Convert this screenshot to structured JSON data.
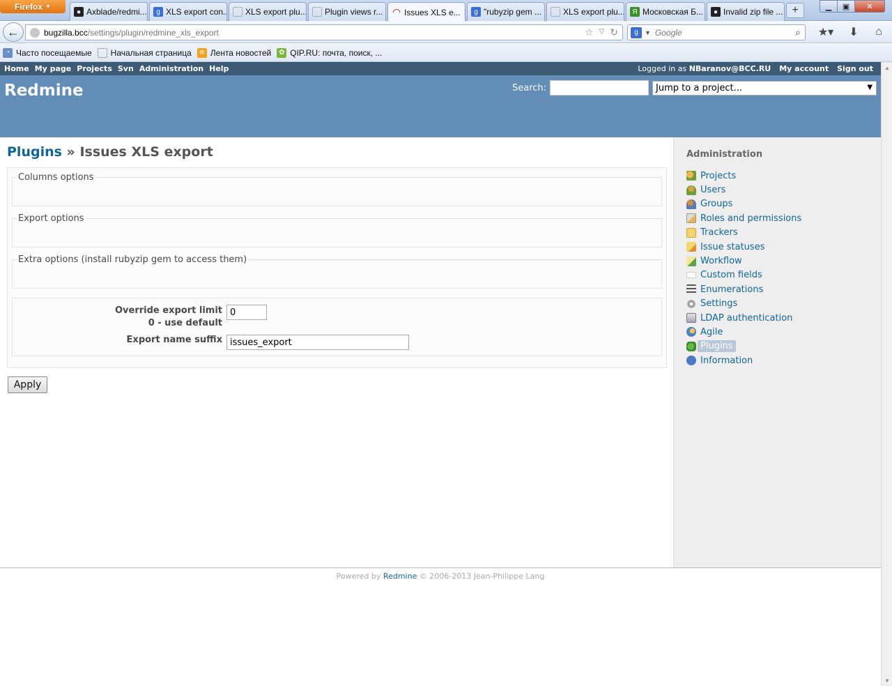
{
  "browser": {
    "menu_button": "Firefox",
    "tabs": [
      {
        "label": "Axblade/redmi...",
        "icon": "github-icon"
      },
      {
        "label": "XLS export con...",
        "icon": "google-icon"
      },
      {
        "label": "XLS export plu...",
        "icon": "blank-page-icon"
      },
      {
        "label": "Plugin views r...",
        "icon": "blank-page-icon"
      },
      {
        "label": "Issues XLS e...",
        "icon": "redmine-icon",
        "active": true
      },
      {
        "label": "\"rubyzip gem ...",
        "icon": "google-icon"
      },
      {
        "label": "XLS export plu...",
        "icon": "blank-page-icon"
      },
      {
        "label": "Московская Б...",
        "icon": "yandex-icon"
      },
      {
        "label": "Invalid zip file ...",
        "icon": "github-icon"
      }
    ],
    "url_host": "bugzilla.bcc",
    "url_path": "/settings/plugin/redmine_xls_export",
    "search_placeholder": "Google",
    "bookmarks": [
      {
        "label": "Часто посещаемые",
        "icon": "most-visited-icon"
      },
      {
        "label": "Начальная страница",
        "icon": "blank-page-icon"
      },
      {
        "label": "Лента новостей",
        "icon": "rss-icon"
      },
      {
        "label": "QIP.RU: почта, поиск, ...",
        "icon": "qip-icon"
      }
    ]
  },
  "top_menu": {
    "items": [
      "Home",
      "My page",
      "Projects",
      "Svn",
      "Administration",
      "Help"
    ],
    "logged_in_prefix": "Logged in as",
    "logged_in_user": "NBaranov@BCC.RU",
    "my_account": "My account",
    "sign_out": "Sign out"
  },
  "header": {
    "site_title": "Redmine",
    "search_label": "Search:",
    "jump_placeholder": "Jump to a project..."
  },
  "content": {
    "breadcrumb_link": "Plugins",
    "breadcrumb_sep": "»",
    "title": "Issues XLS export",
    "fieldsets": {
      "columns": "Columns options",
      "export": "Export options",
      "extra": "Extra options (install rubyzip gem to access them)"
    },
    "fields": {
      "limit_label": "Override export limit",
      "limit_hint": "0 - use default",
      "limit_value": "0",
      "suffix_label": "Export name suffix",
      "suffix_value": "issues_export"
    },
    "apply": "Apply"
  },
  "sidebar": {
    "title": "Administration",
    "items": [
      {
        "label": "Projects",
        "icon": "projects-icon"
      },
      {
        "label": "Users",
        "icon": "users-icon"
      },
      {
        "label": "Groups",
        "icon": "groups-icon"
      },
      {
        "label": "Roles and permissions",
        "icon": "roles-icon"
      },
      {
        "label": "Trackers",
        "icon": "trackers-icon"
      },
      {
        "label": "Issue statuses",
        "icon": "issue-statuses-icon"
      },
      {
        "label": "Workflow",
        "icon": "workflow-icon"
      },
      {
        "label": "Custom fields",
        "icon": "custom-fields-icon"
      },
      {
        "label": "Enumerations",
        "icon": "enumerations-icon"
      },
      {
        "label": "Settings",
        "icon": "settings-icon"
      },
      {
        "label": "LDAP authentication",
        "icon": "ldap-icon"
      },
      {
        "label": "Agile",
        "icon": "agile-icon"
      },
      {
        "label": "Plugins",
        "icon": "plugins-icon",
        "selected": true
      },
      {
        "label": "Information",
        "icon": "information-icon"
      }
    ]
  },
  "footer": {
    "powered_by": "Powered by",
    "link": "Redmine",
    "copyright": "© 2006-2013 Jean-Philippe Lang"
  },
  "colors": {
    "header_bg": "#628db6",
    "top_menu_bg": "#3e5b76",
    "link": "#116699",
    "sidebar_bg": "#eeeeee"
  }
}
